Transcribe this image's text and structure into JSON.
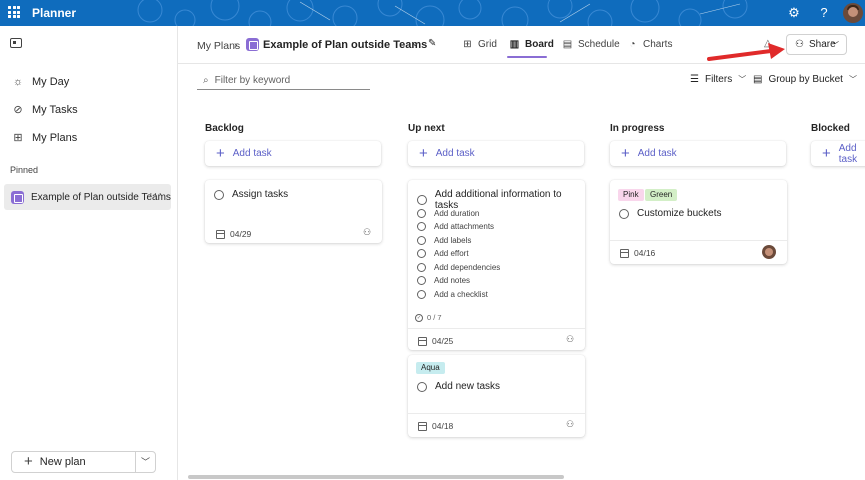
{
  "app": {
    "title": "Planner"
  },
  "sidebar": {
    "nav": [
      {
        "label": "My Day",
        "icon": "sun-icon"
      },
      {
        "label": "My Tasks",
        "icon": "tasks-icon"
      },
      {
        "label": "My Plans",
        "icon": "grid-icon"
      }
    ],
    "pinned_label": "Pinned",
    "pinned_item": "Example of Plan outside Teams",
    "new_plan": "New plan"
  },
  "header": {
    "breadcrumb_root": "My Plans",
    "plan_title": "Example of Plan outside Teams",
    "tabs": [
      {
        "label": "Grid",
        "icon": "grid-icon"
      },
      {
        "label": "Board",
        "icon": "board-icon",
        "active": true
      },
      {
        "label": "Schedule",
        "icon": "schedule-icon"
      },
      {
        "label": "Charts",
        "icon": "charts-icon"
      }
    ],
    "share_label": "Share"
  },
  "toolbar": {
    "filter_placeholder": "Filter by keyword",
    "filters_label": "Filters",
    "group_label": "Group by Bucket"
  },
  "board": {
    "add_task_label": "Add task",
    "buckets": [
      {
        "title": "Backlog"
      },
      {
        "title": "Up next"
      },
      {
        "title": "In progress"
      },
      {
        "title": "Blocked"
      }
    ],
    "cards": {
      "assign": {
        "title": "Assign tasks",
        "due": "04/29"
      },
      "additional": {
        "title": "Add additional information to tasks",
        "checklist": [
          "Add duration",
          "Add attachments",
          "Add labels",
          "Add effort",
          "Add dependencies",
          "Add notes",
          "Add a checklist"
        ],
        "progress": "0 / 7",
        "due": "04/25"
      },
      "newtasks": {
        "label": "Aqua",
        "title": "Add new tasks",
        "due": "04/18"
      },
      "customize": {
        "labels": [
          "Pink",
          "Green"
        ],
        "title": "Customize buckets",
        "due": "04/16"
      }
    }
  },
  "colors": {
    "topbar": "#0f6cbd",
    "accent": "#5b5fc7",
    "plan_icon": "#8a6dd4",
    "arrow": "#e02a2a",
    "label_pink": "#f9d6ec",
    "label_green": "#d3efc7",
    "label_aqua": "#c6ecef"
  }
}
